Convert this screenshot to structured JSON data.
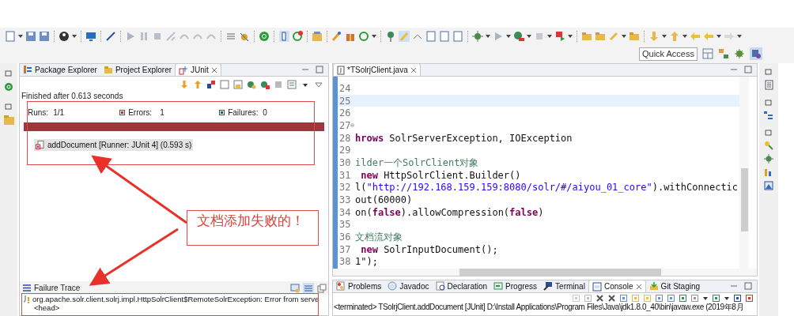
{
  "toolbar": {
    "quick_access": "Quick Access"
  },
  "left_tabs": [
    {
      "label": "Package Explorer",
      "selected": false
    },
    {
      "label": "Project Explorer",
      "selected": false
    },
    {
      "label": "JUnit",
      "selected": true
    }
  ],
  "junit": {
    "status": "Finished after 0.613 seconds",
    "runs_label": "Runs:",
    "runs": "1/1",
    "errors_label": "Errors:",
    "errors": "1",
    "failures_label": "Failures:",
    "failures": "0",
    "progress": {
      "level": 1,
      "failed": true
    },
    "tests": [
      {
        "label": "addDocument [Runner: JUnit 4] (0.593 s)",
        "selected": true
      }
    ]
  },
  "failure_trace": {
    "title": "Failure Trace",
    "lines": [
      "org.apache.solr.client.solrj.impl.HttpSolrClient$RemoteSolrException: Error from serve",
      "<head>"
    ]
  },
  "editor": {
    "tabs": [
      {
        "label": "*TSolrjClient.java",
        "selected": true
      }
    ],
    "lines": [
      {
        "number": "24",
        "highlighted": false
      },
      {
        "number": "25",
        "highlighted": true
      },
      {
        "number": "26",
        "highlighted": false
      },
      {
        "number": "27",
        "highlighted": false,
        "fold": true
      },
      {
        "number": "28",
        "highlighted": false,
        "segments": [
          {
            "kind": "keyword",
            "text": "hrows"
          },
          {
            "kind": "plain",
            "text": " SolrServerException, IOException"
          }
        ]
      },
      {
        "number": "29",
        "highlighted": false
      },
      {
        "number": "30",
        "highlighted": false,
        "segments": [
          {
            "kind": "comment",
            "text": "ilder一个SolrClient对象"
          }
        ]
      },
      {
        "number": "31",
        "highlighted": false,
        "segments": [
          {
            "kind": "keyword",
            "text": " new"
          },
          {
            "kind": "plain",
            "text": " HttpSolrClient.Builder()"
          }
        ]
      },
      {
        "number": "32",
        "highlighted": false,
        "segments": [
          {
            "kind": "plain",
            "text": "l("
          },
          {
            "kind": "string",
            "text": "\"http://192.168.159.159:8080/solr/#/aiyou_01_core\""
          },
          {
            "kind": "plain",
            "text": ").withConnectic"
          }
        ]
      },
      {
        "number": "33",
        "highlighted": false,
        "segments": [
          {
            "kind": "plain",
            "text": "out(60000)"
          }
        ]
      },
      {
        "number": "34",
        "highlighted": false,
        "segments": [
          {
            "kind": "plain",
            "text": "on("
          },
          {
            "kind": "keyword",
            "text": "false"
          },
          {
            "kind": "plain",
            "text": ").allowCompression("
          },
          {
            "kind": "keyword",
            "text": "false"
          },
          {
            "kind": "plain",
            "text": ")"
          }
        ]
      },
      {
        "number": "35",
        "highlighted": false
      },
      {
        "number": "36",
        "highlighted": false,
        "segments": [
          {
            "kind": "comment",
            "text": "文档流对象"
          }
        ]
      },
      {
        "number": "37",
        "highlighted": false,
        "segments": [
          {
            "kind": "keyword",
            "text": " new"
          },
          {
            "kind": "plain",
            "text": " SolrInputDocument();"
          }
        ]
      },
      {
        "number": "38",
        "highlighted": false,
        "segments": [
          {
            "kind": "plain",
            "text": "1\");"
          }
        ]
      }
    ]
  },
  "bottom_tabs": [
    {
      "label": "Problems",
      "selected": false
    },
    {
      "label": "Javadoc",
      "selected": false
    },
    {
      "label": "Declaration",
      "selected": false
    },
    {
      "label": "Progress",
      "selected": false
    },
    {
      "label": "Terminal",
      "selected": false
    },
    {
      "label": "Console",
      "selected": true
    },
    {
      "label": "Git Staging",
      "selected": false
    }
  ],
  "console": {
    "lines": [
      "<terminated> TSolrjClient.addDocument [JUnit] D:\\Install Applications\\Program Files\\Java\\jdk1.8.0_40\\bin\\javaw.exe (2019年8月"
    ]
  },
  "annotation": {
    "text": "文档添加失败的！"
  }
}
